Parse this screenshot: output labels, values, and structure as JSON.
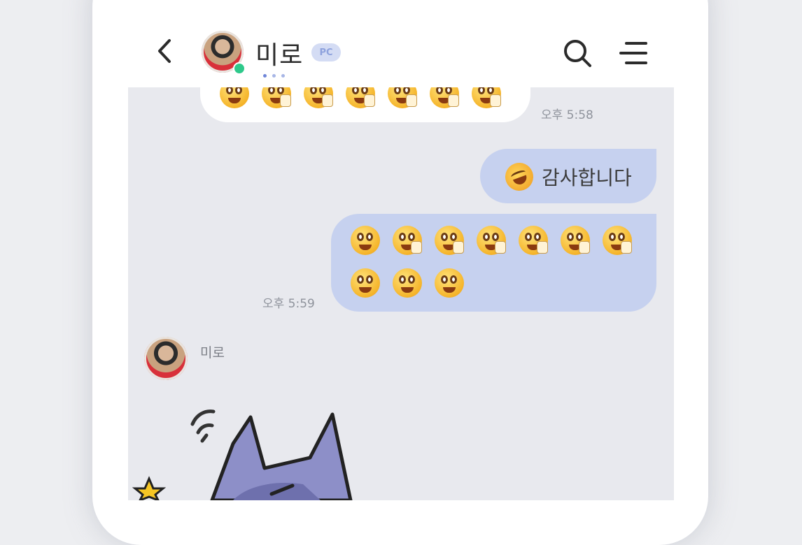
{
  "header": {
    "back_icon": "chevron-left-icon",
    "chat_title": "미로",
    "device_badge": "PC",
    "search_icon": "search-icon",
    "menu_icon": "menu-icon"
  },
  "messages": [
    {
      "side": "received",
      "type": "emoji-row",
      "emoji": "surprised-emoji",
      "count": 7,
      "time": "오후 5:58"
    },
    {
      "side": "sent",
      "type": "text",
      "emoji": "laughing-emoji",
      "text": "감사합니다"
    },
    {
      "side": "sent",
      "type": "emoji-grid",
      "emoji": "surprised-emoji",
      "count": 10,
      "time": "오후 5:59"
    },
    {
      "side": "received",
      "type": "sticker",
      "sender": "미로",
      "sticker": "purple-cat-sticker"
    }
  ],
  "colors": {
    "sent_bubble": "#c6d1ef",
    "received_bubble": "#ffffff",
    "chat_background": "#e8e9ee",
    "online_status": "#2ec98b",
    "badge": "#d4dcf4"
  }
}
